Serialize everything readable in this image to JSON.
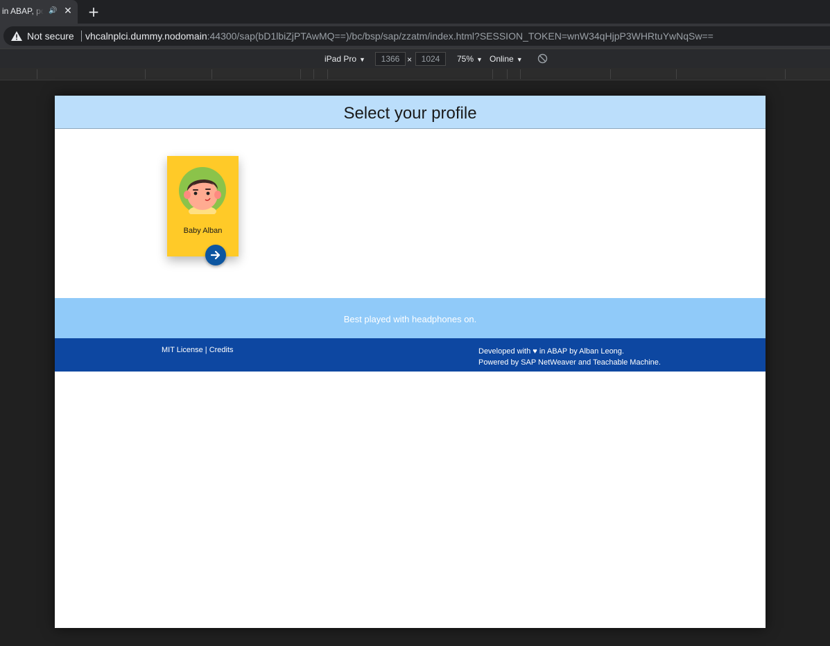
{
  "browser": {
    "tab": {
      "title": "in ABAP, po",
      "audio_icon": "speaker-icon",
      "close_icon": "close-icon"
    },
    "new_tab_icon": "plus-icon",
    "omnibox": {
      "security_label": "Not secure",
      "url_host": "vhcalnplci.dummy.nodomain",
      "url_rest": ":44300/sap(bD1lbiZjPTAwMQ==)/bc/bsp/sap/zzatm/index.html?SESSION_TOKEN=wnW34qHjpP3WHRtuYwNqSw=="
    }
  },
  "devtools": {
    "device": "iPad Pro",
    "width": "1366",
    "x": "×",
    "height": "1024",
    "zoom": "75%",
    "network": "Online",
    "caret": "▼"
  },
  "page": {
    "title": "Select your profile",
    "profiles": [
      {
        "name": "Baby Alban",
        "avatar_icon": "baby-avatar-icon",
        "action_icon": "arrow-right-icon"
      }
    ],
    "banner": "Best played with headphones on.",
    "footer": {
      "license": "MIT License",
      "divider": "|",
      "credits": "Credits",
      "developed": "Developed with ♥ in ABAP by Alban Leong.",
      "powered": "Powered by SAP NetWeaver and Teachable Machine."
    },
    "colors": {
      "header_bg": "#bbdefb",
      "card_bg": "#ffca28",
      "banner_bg": "#90caf9",
      "footer_bg": "#0d47a1",
      "button_bg": "#0d56a0"
    }
  }
}
